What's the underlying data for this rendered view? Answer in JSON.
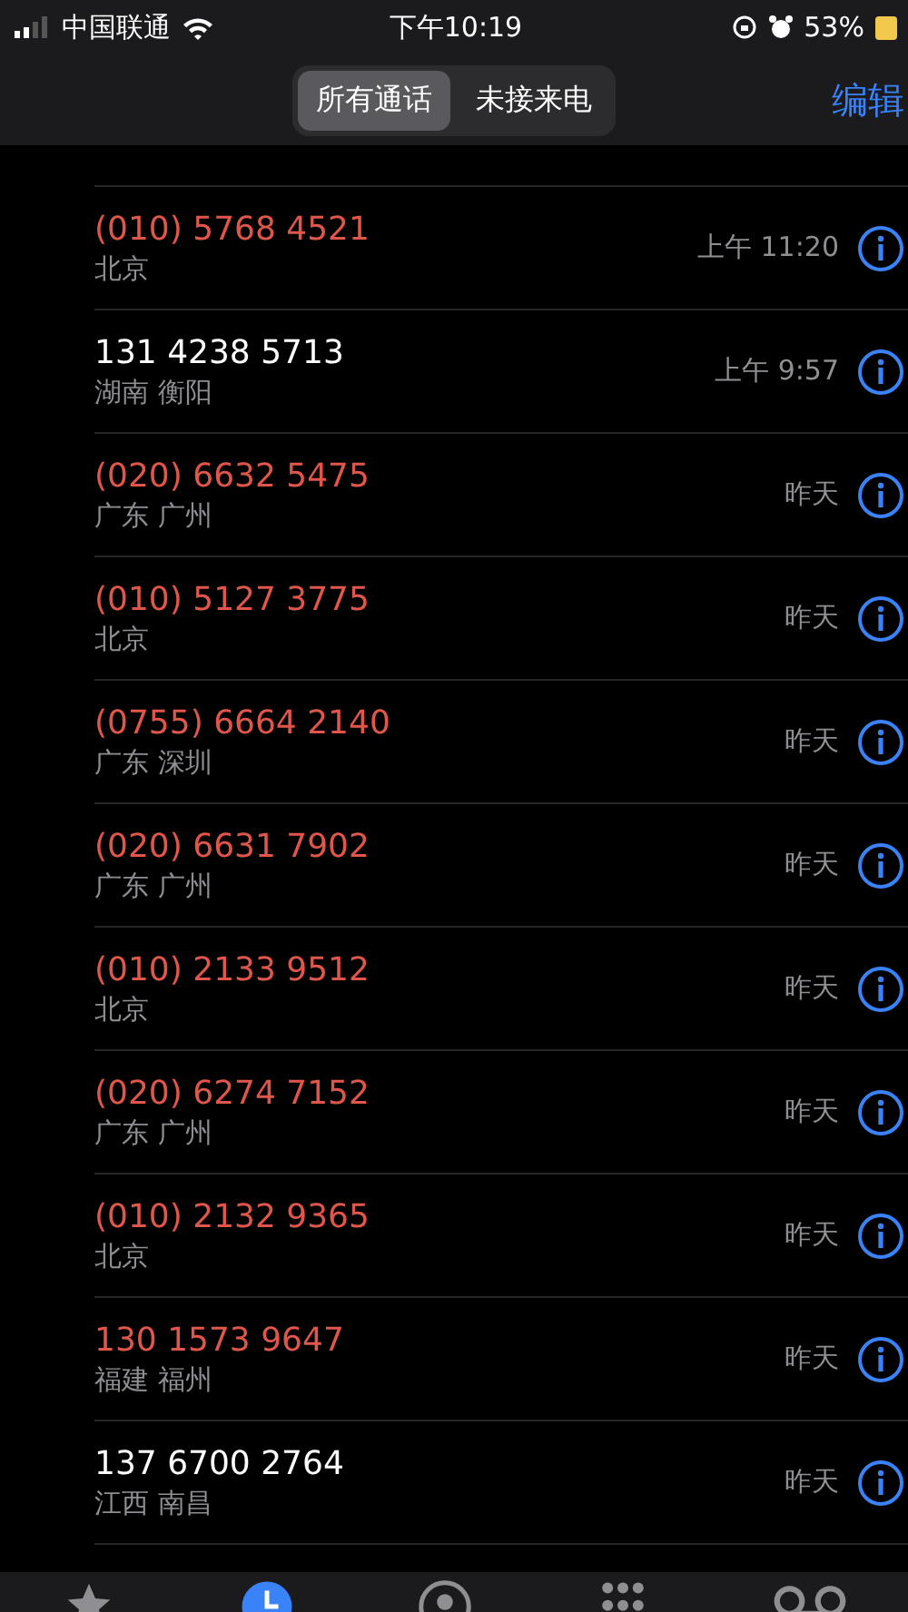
{
  "status_bar": {
    "carrier": "中国联通",
    "time": "下午10:19",
    "battery": "53%"
  },
  "nav": {
    "segments": [
      {
        "label": "所有通话",
        "selected": true
      },
      {
        "label": "未接来电",
        "selected": false
      }
    ],
    "edit": "编辑"
  },
  "calls": [
    {
      "number": "(010) 5768 4521",
      "location": "北京",
      "time": "上午 11:20",
      "missed": true
    },
    {
      "number": "131 4238 5713",
      "location": "湖南 衡阳",
      "time": "上午 9:57",
      "missed": false
    },
    {
      "number": "(020) 6632 5475",
      "location": "广东 广州",
      "time": "昨天",
      "missed": true
    },
    {
      "number": "(010) 5127 3775",
      "location": "北京",
      "time": "昨天",
      "missed": true
    },
    {
      "number": "(0755) 6664 2140",
      "location": "广东 深圳",
      "time": "昨天",
      "missed": true
    },
    {
      "number": "(020) 6631 7902",
      "location": "广东 广州",
      "time": "昨天",
      "missed": true
    },
    {
      "number": "(010) 2133 9512",
      "location": "北京",
      "time": "昨天",
      "missed": true
    },
    {
      "number": "(020) 6274 7152",
      "location": "广东 广州",
      "time": "昨天",
      "missed": true
    },
    {
      "number": "(010) 2132 9365",
      "location": "北京",
      "time": "昨天",
      "missed": true
    },
    {
      "number": "130 1573 9647",
      "location": "福建 福州",
      "time": "昨天",
      "missed": true
    },
    {
      "number": "137 6700 2764",
      "location": "江西 南昌",
      "time": "昨天",
      "missed": false
    }
  ],
  "tab_bar": {
    "tabs": [
      {
        "kind": "favorites",
        "selected": false
      },
      {
        "kind": "recents",
        "selected": true
      },
      {
        "kind": "contacts",
        "selected": false
      },
      {
        "kind": "keypad",
        "selected": false
      },
      {
        "kind": "voicemail",
        "selected": false
      }
    ]
  }
}
